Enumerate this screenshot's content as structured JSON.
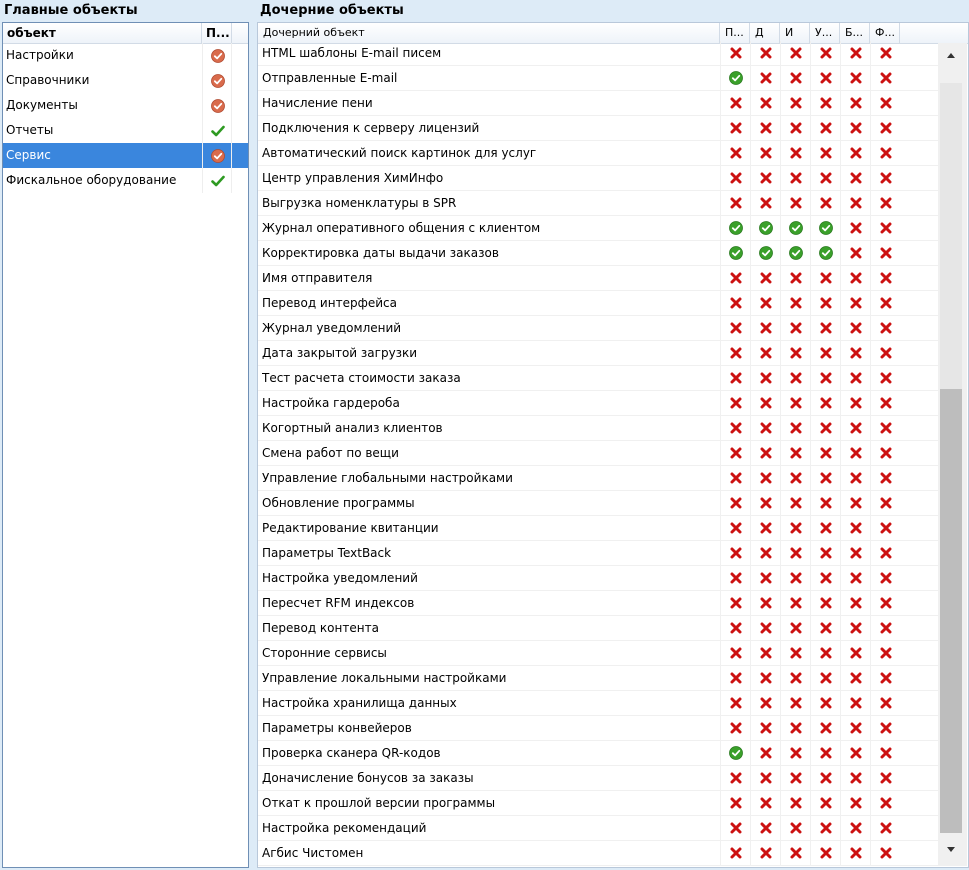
{
  "left_title": "Главные объекты",
  "right_title": "Дочерние объекты",
  "left_table": {
    "headers": [
      "объект",
      "П..."
    ],
    "rows": [
      {
        "name": "Настройки",
        "status": "partial"
      },
      {
        "name": "Справочники",
        "status": "partial"
      },
      {
        "name": "Документы",
        "status": "partial"
      },
      {
        "name": "Отчеты",
        "status": "full"
      },
      {
        "name": "Сервис",
        "status": "partial"
      },
      {
        "name": "Фискальное оборудование",
        "status": "full"
      }
    ],
    "selected_index": 4
  },
  "right_table": {
    "headers": [
      "Дочерний объект",
      "П...",
      "Д",
      "И",
      "У...",
      "Б...",
      "Ф..."
    ],
    "rows": [
      {
        "name": "HTML шаблоны E-mail писем",
        "perms": [
          0,
          0,
          0,
          0,
          0,
          0
        ]
      },
      {
        "name": "Отправленные E-mail",
        "perms": [
          1,
          0,
          0,
          0,
          0,
          0
        ]
      },
      {
        "name": "Начисление пени",
        "perms": [
          0,
          0,
          0,
          0,
          0,
          0
        ]
      },
      {
        "name": "Подключения к серверу лицензий",
        "perms": [
          0,
          0,
          0,
          0,
          0,
          0
        ]
      },
      {
        "name": "Автоматический поиск картинок для услуг",
        "perms": [
          0,
          0,
          0,
          0,
          0,
          0
        ]
      },
      {
        "name": "Центр управления ХимИнфо",
        "perms": [
          0,
          0,
          0,
          0,
          0,
          0
        ]
      },
      {
        "name": "Выгрузка номенклатуры в SPR",
        "perms": [
          0,
          0,
          0,
          0,
          0,
          0
        ]
      },
      {
        "name": "Журнал оперативного общения с клиентом",
        "perms": [
          1,
          1,
          1,
          1,
          0,
          0
        ]
      },
      {
        "name": "Корректировка даты выдачи заказов",
        "perms": [
          1,
          1,
          1,
          1,
          0,
          0
        ]
      },
      {
        "name": "Имя отправителя",
        "perms": [
          0,
          0,
          0,
          0,
          0,
          0
        ]
      },
      {
        "name": "Перевод интерфейса",
        "perms": [
          0,
          0,
          0,
          0,
          0,
          0
        ]
      },
      {
        "name": "Журнал уведомлений",
        "perms": [
          0,
          0,
          0,
          0,
          0,
          0
        ]
      },
      {
        "name": "Дата закрытой загрузки",
        "perms": [
          0,
          0,
          0,
          0,
          0,
          0
        ]
      },
      {
        "name": "Тест расчета стоимости заказа",
        "perms": [
          0,
          0,
          0,
          0,
          0,
          0
        ]
      },
      {
        "name": "Настройка гардероба",
        "perms": [
          0,
          0,
          0,
          0,
          0,
          0
        ]
      },
      {
        "name": "Когортный анализ клиентов",
        "perms": [
          0,
          0,
          0,
          0,
          0,
          0
        ]
      },
      {
        "name": "Смена работ по вещи",
        "perms": [
          0,
          0,
          0,
          0,
          0,
          0
        ]
      },
      {
        "name": "Управление глобальными настройками",
        "perms": [
          0,
          0,
          0,
          0,
          0,
          0
        ]
      },
      {
        "name": "Обновление программы",
        "perms": [
          0,
          0,
          0,
          0,
          0,
          0
        ]
      },
      {
        "name": "Редактирование квитанции",
        "perms": [
          0,
          0,
          0,
          0,
          0,
          0
        ]
      },
      {
        "name": "Параметры TextBack",
        "perms": [
          0,
          0,
          0,
          0,
          0,
          0
        ]
      },
      {
        "name": "Настройка уведомлений",
        "perms": [
          0,
          0,
          0,
          0,
          0,
          0
        ]
      },
      {
        "name": "Пересчет RFM индексов",
        "perms": [
          0,
          0,
          0,
          0,
          0,
          0
        ]
      },
      {
        "name": "Перевод контента",
        "perms": [
          0,
          0,
          0,
          0,
          0,
          0
        ]
      },
      {
        "name": "Сторонние сервисы",
        "perms": [
          0,
          0,
          0,
          0,
          0,
          0
        ]
      },
      {
        "name": "Управление локальными настройками",
        "perms": [
          0,
          0,
          0,
          0,
          0,
          0
        ]
      },
      {
        "name": "Настройка хранилища данных",
        "perms": [
          0,
          0,
          0,
          0,
          0,
          0
        ]
      },
      {
        "name": "Параметры конвейеров",
        "perms": [
          0,
          0,
          0,
          0,
          0,
          0
        ]
      },
      {
        "name": "Проверка сканера QR-кодов",
        "perms": [
          1,
          0,
          0,
          0,
          0,
          0
        ]
      },
      {
        "name": "Доначисление бонусов за заказы",
        "perms": [
          0,
          0,
          0,
          0,
          0,
          0
        ]
      },
      {
        "name": "Откат к прошлой версии программы",
        "perms": [
          0,
          0,
          0,
          0,
          0,
          0
        ]
      },
      {
        "name": "Настройка рекомендаций",
        "perms": [
          0,
          0,
          0,
          0,
          0,
          0
        ]
      },
      {
        "name": "Агбис Чистомен",
        "perms": [
          0,
          0,
          0,
          0,
          0,
          0
        ]
      }
    ]
  },
  "icon_names": {
    "full": "green-check-icon",
    "partial": "partial-access-icon",
    "allowed": "green-check-circle-icon",
    "denied": "red-x-icon"
  },
  "colors": {
    "selection": "#3a86dd",
    "denied": "#cc1111",
    "allowed": "#3aa02a",
    "partial": "#d96b4c"
  }
}
